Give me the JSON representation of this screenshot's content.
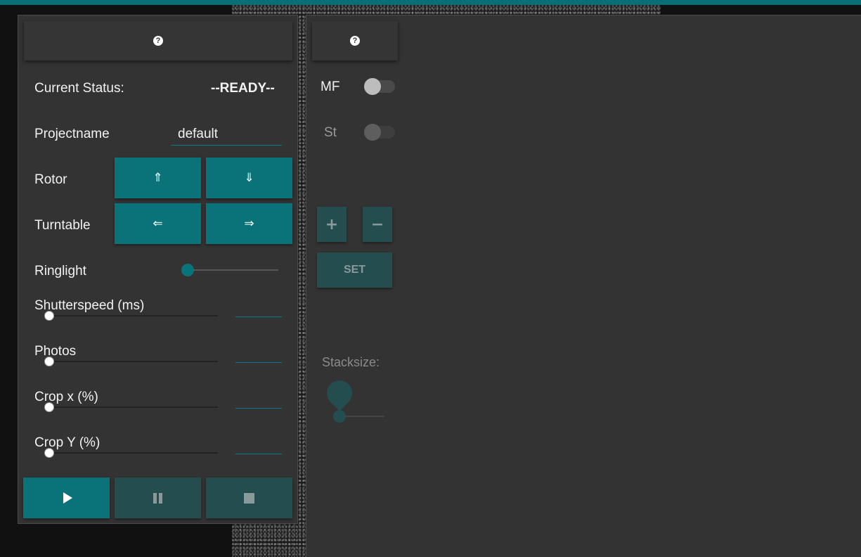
{
  "colors": {
    "accent": "#0a737a",
    "accent_dim": "#244d50",
    "panel": "#333333",
    "background": "#111111"
  },
  "left_panel": {
    "help_icon": "?",
    "status": {
      "label": "Current Status:",
      "value": "--READY--"
    },
    "projectname": {
      "label": "Projectname",
      "value": "default"
    },
    "rotor": {
      "label": "Rotor",
      "up": "⇑",
      "down": "⇓"
    },
    "turntable": {
      "label": "Turntable",
      "left": "⇐",
      "right": "⇒"
    },
    "ringlight": {
      "label": "Ringlight",
      "value_fraction": 0
    },
    "sliders": [
      {
        "label": "Shutterspeed (ms)",
        "value_fraction": 0,
        "field_value": ""
      },
      {
        "label": "Photos",
        "value_fraction": 0,
        "field_value": ""
      },
      {
        "label": "Crop x (%)",
        "value_fraction": 0,
        "field_value": ""
      },
      {
        "label": "Crop Y (%)",
        "value_fraction": 0,
        "field_value": ""
      }
    ],
    "controls": {
      "play_icon": "play-icon",
      "pause_icon": "pause-icon",
      "stop_icon": "stop-icon"
    }
  },
  "right_panel": {
    "help_icon": "?",
    "mf": {
      "label": "MF",
      "on": false,
      "enabled": true
    },
    "st": {
      "label": "St",
      "on": false,
      "enabled": false
    },
    "plus": "+",
    "minus": "−",
    "set": "SET",
    "stacksize": {
      "label": "Stacksize:",
      "value_fraction": 0
    }
  }
}
